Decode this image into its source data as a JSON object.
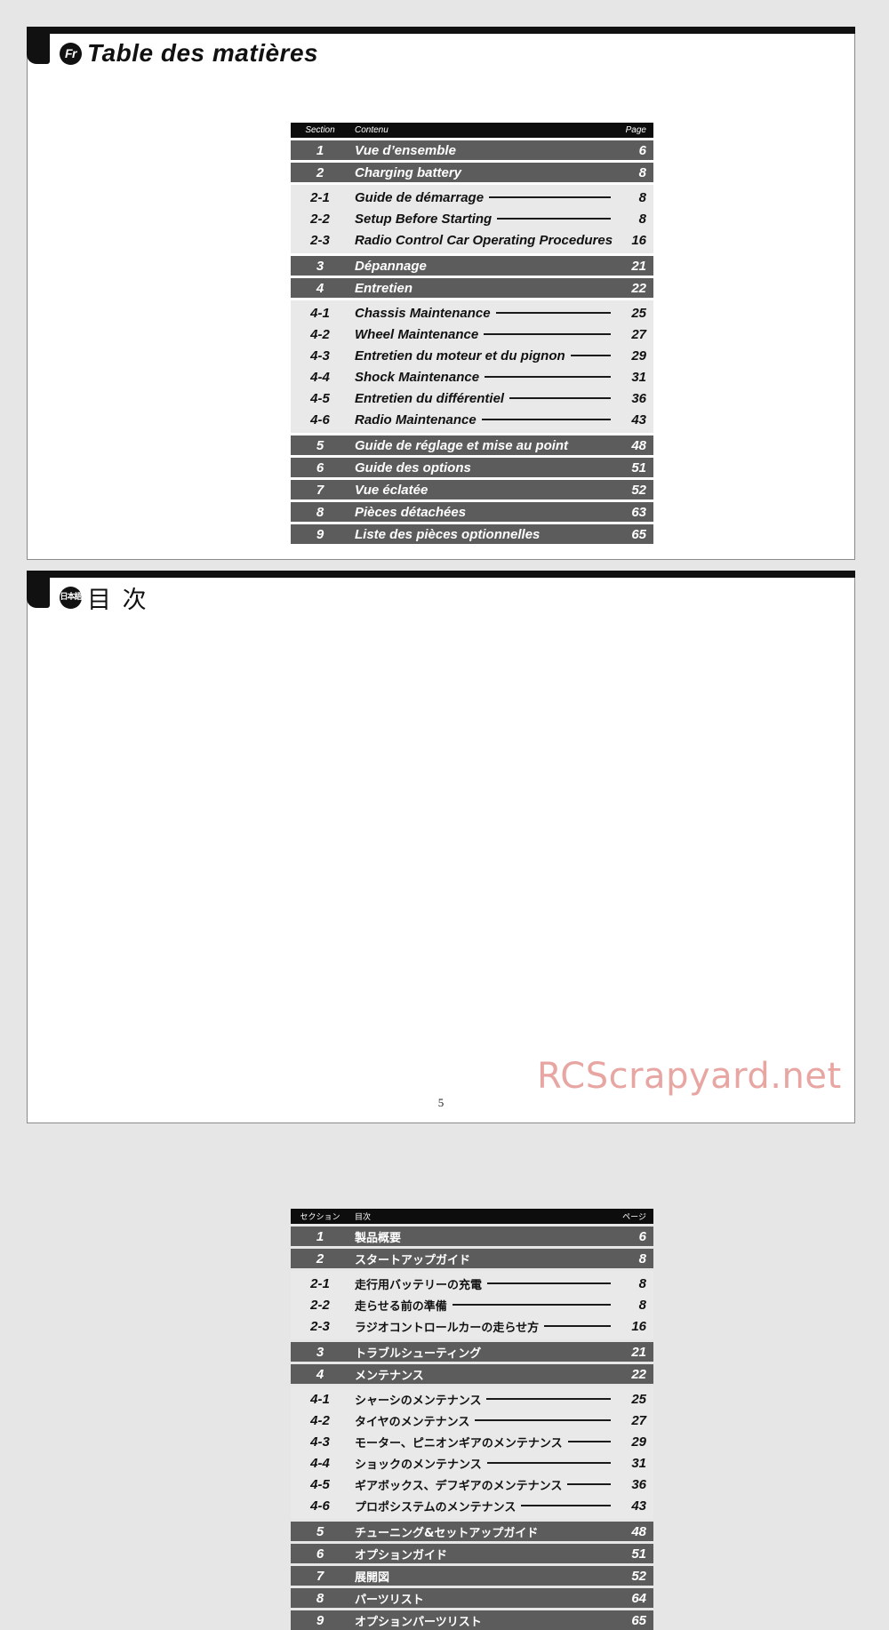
{
  "page": {
    "number": "5",
    "watermark": "RCScrapyard.net"
  },
  "sections": [
    {
      "badge": "Fr",
      "title": "Table des matières",
      "headers": {
        "section": "Section",
        "content": "Contenu",
        "page": "Page"
      },
      "rows": [
        {
          "type": "major",
          "num": "1",
          "label": "Vue d’ensemble",
          "page": "6"
        },
        {
          "type": "major",
          "num": "2",
          "label": "Charging battery",
          "page": "8"
        },
        {
          "type": "sub",
          "num": "2-1",
          "label": "Guide de démarrage",
          "page": "8"
        },
        {
          "type": "sub",
          "num": "2-2",
          "label": "Setup Before Starting",
          "page": "8"
        },
        {
          "type": "sub",
          "num": "2-3",
          "label": "Radio Control Car Operating Procedures",
          "page": "16"
        },
        {
          "type": "major",
          "num": "3",
          "label": "Dépannage",
          "page": "21"
        },
        {
          "type": "major",
          "num": "4",
          "label": "Entretien",
          "page": "22"
        },
        {
          "type": "sub",
          "num": "4-1",
          "label": "Chassis Maintenance",
          "page": "25"
        },
        {
          "type": "sub",
          "num": "4-2",
          "label": "Wheel Maintenance",
          "page": "27"
        },
        {
          "type": "sub",
          "num": "4-3",
          "label": "Entretien du moteur et du pignon",
          "page": "29"
        },
        {
          "type": "sub",
          "num": "4-4",
          "label": "Shock Maintenance",
          "page": "31"
        },
        {
          "type": "sub",
          "num": "4-5",
          "label": "Entretien du différentiel",
          "page": "36"
        },
        {
          "type": "sub",
          "num": "4-6",
          "label": "Radio Maintenance",
          "page": "43"
        },
        {
          "type": "major",
          "num": "5",
          "label": "Guide de réglage et mise au point",
          "page": "48"
        },
        {
          "type": "major",
          "num": "6",
          "label": "Guide des options",
          "page": "51"
        },
        {
          "type": "major",
          "num": "7",
          "label": "Vue éclatée",
          "page": "52"
        },
        {
          "type": "major",
          "num": "8",
          "label": "Pièces détachées",
          "page": "63"
        },
        {
          "type": "major",
          "num": "9",
          "label": "Liste des pièces optionnelles",
          "page": "65"
        }
      ]
    },
    {
      "badge": "日本語",
      "title": "目 次",
      "headers": {
        "section": "セクション",
        "content": "目次",
        "page": "ページ"
      },
      "rows": [
        {
          "type": "major",
          "num": "1",
          "label": "製品概要",
          "page": "6"
        },
        {
          "type": "major",
          "num": "2",
          "label": "スタートアップガイド",
          "page": "8"
        },
        {
          "type": "sub",
          "num": "2-1",
          "label": "走行用バッテリーの充電",
          "page": "8"
        },
        {
          "type": "sub",
          "num": "2-2",
          "label": "走らせる前の準備",
          "page": "8"
        },
        {
          "type": "sub",
          "num": "2-3",
          "label": "ラジオコントロールカーの走らせ方",
          "page": "16"
        },
        {
          "type": "major",
          "num": "3",
          "label": "トラブルシューティング",
          "page": "21"
        },
        {
          "type": "major",
          "num": "4",
          "label": "メンテナンス",
          "page": "22"
        },
        {
          "type": "sub",
          "num": "4-1",
          "label": "シャーシのメンテナンス",
          "page": "25"
        },
        {
          "type": "sub",
          "num": "4-2",
          "label": "タイヤのメンテナンス",
          "page": "27"
        },
        {
          "type": "sub",
          "num": "4-3",
          "label": "モーター、ピニオンギアのメンテナンス",
          "page": "29"
        },
        {
          "type": "sub",
          "num": "4-4",
          "label": "ショックのメンテナンス",
          "page": "31"
        },
        {
          "type": "sub",
          "num": "4-5",
          "label": "ギアボックス、デフギアのメンテナンス",
          "page": "36"
        },
        {
          "type": "sub",
          "num": "4-6",
          "label": "プロポシステムのメンテナンス",
          "page": "43"
        },
        {
          "type": "major",
          "num": "5",
          "label": "チューニング&セットアップガイド",
          "page": "48"
        },
        {
          "type": "major",
          "num": "6",
          "label": "オプションガイド",
          "page": "51"
        },
        {
          "type": "major",
          "num": "7",
          "label": "展開図",
          "page": "52"
        },
        {
          "type": "major",
          "num": "8",
          "label": "パーツリスト",
          "page": "64"
        },
        {
          "type": "major",
          "num": "9",
          "label": "オプションパーツリスト",
          "page": "65"
        }
      ]
    }
  ]
}
